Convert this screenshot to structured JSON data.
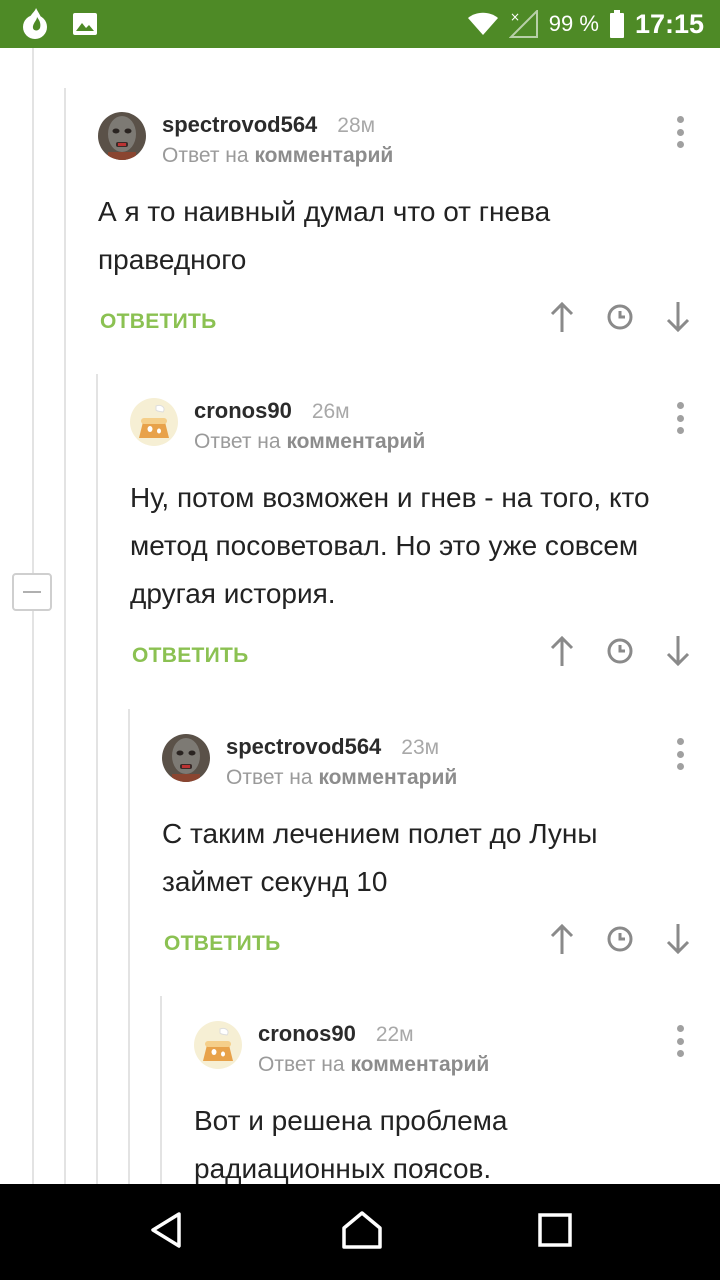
{
  "status_bar": {
    "battery_percent": "99 %",
    "time": "17:15",
    "icons": [
      "tinder-flame-icon",
      "gallery-icon",
      "wifi-icon",
      "signal-icon",
      "battery-icon"
    ]
  },
  "comments": [
    {
      "username": "spectrovod564",
      "time": "28м",
      "reply_prefix": "Ответ на",
      "reply_target": "комментарий",
      "text": "А я то наивный думал что от гнева праведного",
      "reply_label": "ОТВЕТИТЬ",
      "avatar": "zombie-avatar"
    },
    {
      "username": "cronos90",
      "time": "26м",
      "reply_prefix": "Ответ на",
      "reply_target": "комментарий",
      "text": "Ну, потом возможен и гнев - на того, кто метод посоветовал. Но это уже совсем другая история.",
      "reply_label": "ОТВЕТИТЬ",
      "avatar": "cake-avatar"
    },
    {
      "username": "spectrovod564",
      "time": "23м",
      "reply_prefix": "Ответ на",
      "reply_target": "комментарий",
      "text": "С таким лечением полет до Луны займет секунд 10",
      "reply_label": "ОТВЕТИТЬ",
      "avatar": "zombie-avatar"
    },
    {
      "username": "cronos90",
      "time": "22м",
      "reply_prefix": "Ответ на",
      "reply_target": "комментарий",
      "text": "Вот и решена проблема радиационных поясов.",
      "avatar": "cake-avatar"
    }
  ],
  "nav_bar": {
    "buttons": [
      "back-icon",
      "home-icon",
      "recents-icon"
    ]
  },
  "colors": {
    "status_bar": "#4e8a26",
    "reply_green": "#8bc152",
    "text": "#222222",
    "muted": "#9a9a9a"
  }
}
